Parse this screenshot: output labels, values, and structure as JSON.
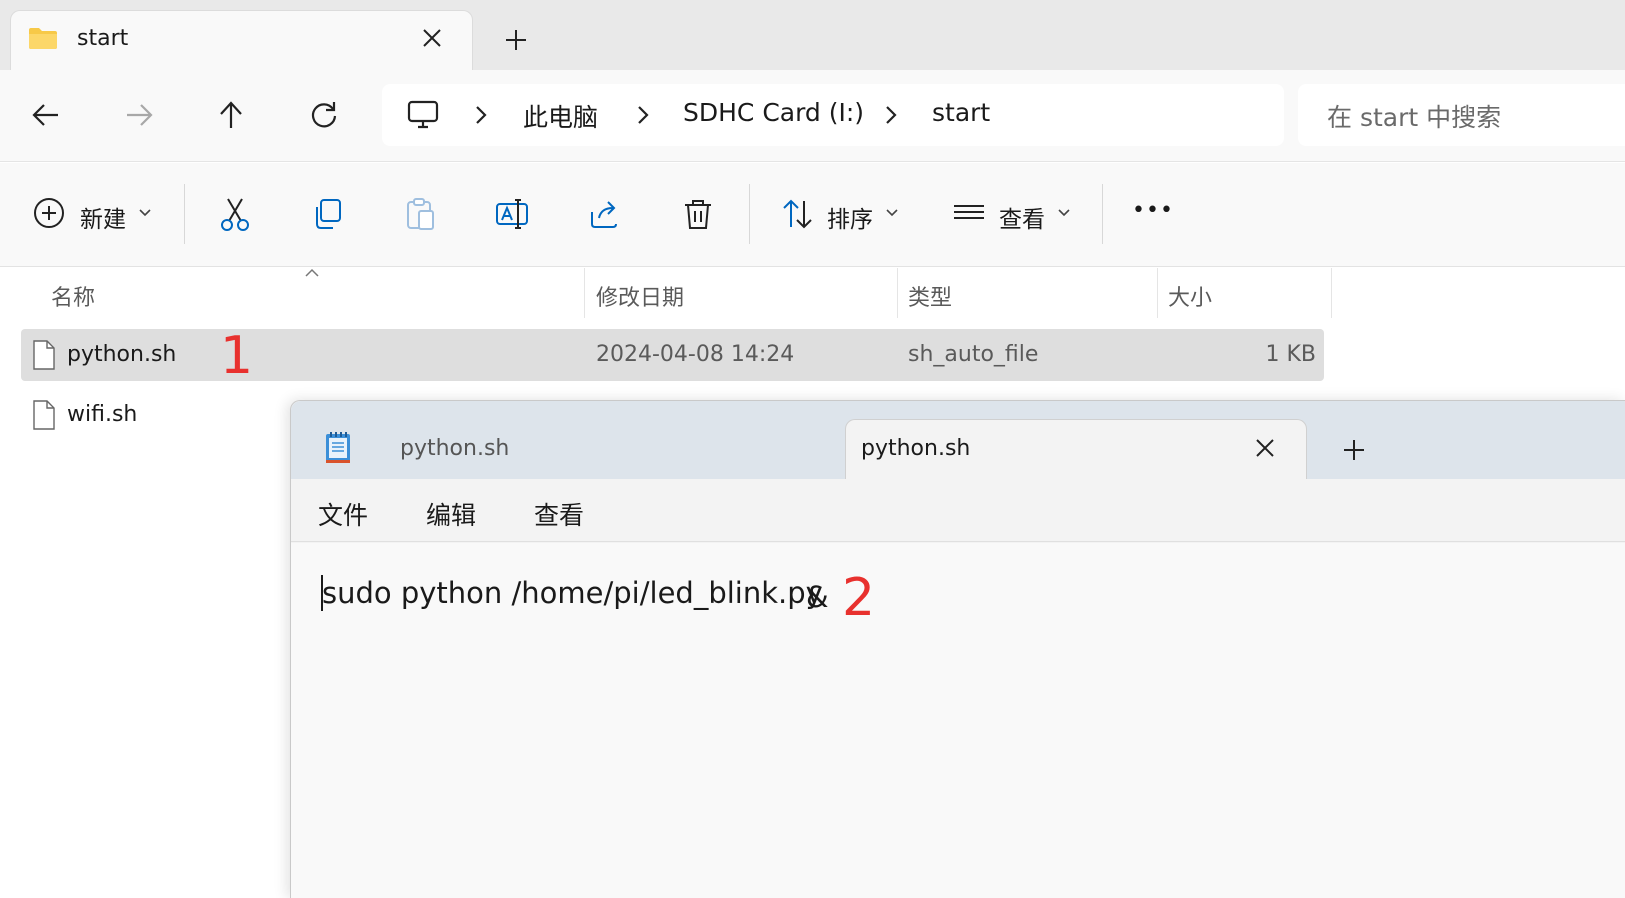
{
  "explorer": {
    "tab_title": "start",
    "breadcrumbs": [
      "此电脑",
      "SDHC Card (I:)",
      "start"
    ],
    "search_placeholder": "在 start 中搜索",
    "toolbar": {
      "new_label": "新建",
      "sort_label": "排序",
      "view_label": "查看",
      "more_label": "•••"
    },
    "columns": [
      "名称",
      "修改日期",
      "类型",
      "大小"
    ],
    "files": [
      {
        "name": "python.sh",
        "modified": "2024-04-08 14:24",
        "type": "sh_auto_file",
        "size": "1 KB",
        "selected": true
      },
      {
        "name": "wifi.sh",
        "modified": "",
        "type": "",
        "size": "",
        "selected": false
      }
    ],
    "annotation_1": "1"
  },
  "notepad": {
    "tabs": [
      "python.sh",
      "python.sh"
    ],
    "active_tab": 1,
    "menu": [
      "文件",
      "编辑",
      "查看"
    ],
    "content": "sudo python /home/pi/led_blink.py",
    "content_tail": "&",
    "annotation_2": "2"
  },
  "colors": {
    "accent_blue": "#0067c0",
    "annotation_red": "#e8312e",
    "selection_gray": "#dedede",
    "folder_yellow": "#f7c948"
  },
  "icons": [
    "folder-icon",
    "close-icon",
    "plus-icon",
    "back-arrow-icon",
    "forward-arrow-icon",
    "up-arrow-icon",
    "refresh-icon",
    "computer-icon",
    "chevron-right-icon",
    "new-icon",
    "cut-icon",
    "copy-icon",
    "paste-icon",
    "rename-icon",
    "share-icon",
    "delete-icon",
    "sort-icon",
    "view-icon",
    "file-icon",
    "notepad-icon"
  ]
}
